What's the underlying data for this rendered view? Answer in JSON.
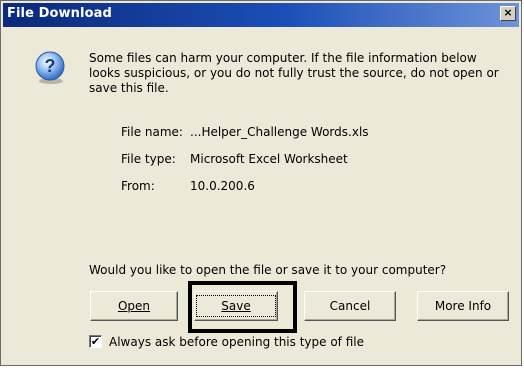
{
  "window": {
    "title": "File Download",
    "close_glyph": "×"
  },
  "message": {
    "warning": "Some files can harm your computer. If the file information below looks suspicious, or you do not fully trust the source, do not open or save this file.",
    "icon": "question-icon"
  },
  "file_info": {
    "name_label": "File name:",
    "name_value": "...Helper_Challenge Words.xls",
    "type_label": "File type:",
    "type_value": "Microsoft Excel Worksheet",
    "from_label": "From:",
    "from_value": "10.0.200.6"
  },
  "prompt": "Would you like to open the file or save it to your computer?",
  "buttons": {
    "open_label": "Open",
    "save_label": "Save",
    "cancel_label": "Cancel",
    "more_info_label": "More Info"
  },
  "checkbox": {
    "checked": true,
    "label": "Always ask before opening this type of file"
  },
  "colors": {
    "titlebar": "#0a2a7a",
    "dialog_bg": "#ece9d8",
    "highlight": "#000000"
  }
}
